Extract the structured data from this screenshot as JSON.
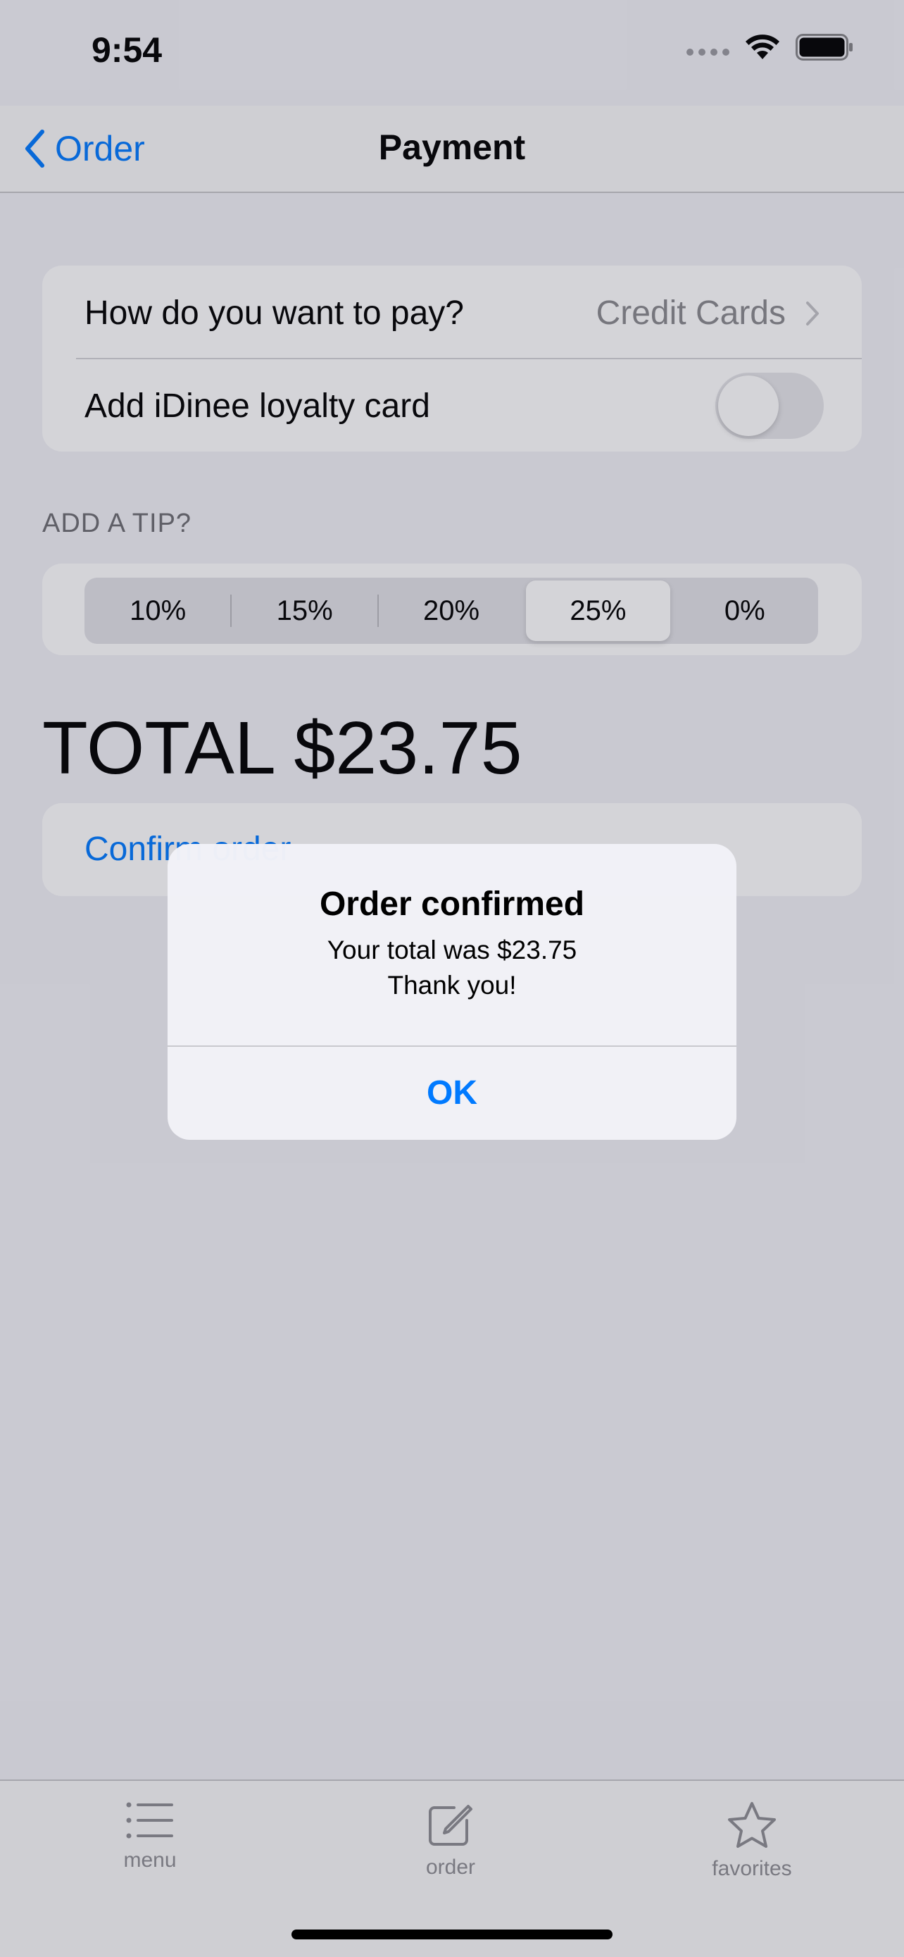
{
  "status_bar": {
    "time": "9:54"
  },
  "nav": {
    "back_label": "Order",
    "title": "Payment"
  },
  "payment": {
    "method_label": "How do you want to pay?",
    "method_value": "Credit Cards",
    "loyalty_label": "Add iDinee loyalty card",
    "loyalty_enabled": false
  },
  "tip": {
    "header": "ADD A TIP?",
    "options": [
      "10%",
      "15%",
      "20%",
      "25%",
      "0%"
    ],
    "selected": "25%"
  },
  "total": {
    "text": "TOTAL $23.75"
  },
  "confirm": {
    "label": "Confirm order"
  },
  "alert": {
    "title": "Order confirmed",
    "message_line1": "Your total was $23.75",
    "message_line2": "Thank you!",
    "button": "OK"
  },
  "tabs": [
    {
      "label": "menu",
      "icon": "list-icon"
    },
    {
      "label": "order",
      "icon": "square-and-pencil-icon"
    },
    {
      "label": "favorites",
      "icon": "star-icon"
    }
  ],
  "colors": {
    "accent": "#007aff",
    "background": "#f2f2f7"
  }
}
